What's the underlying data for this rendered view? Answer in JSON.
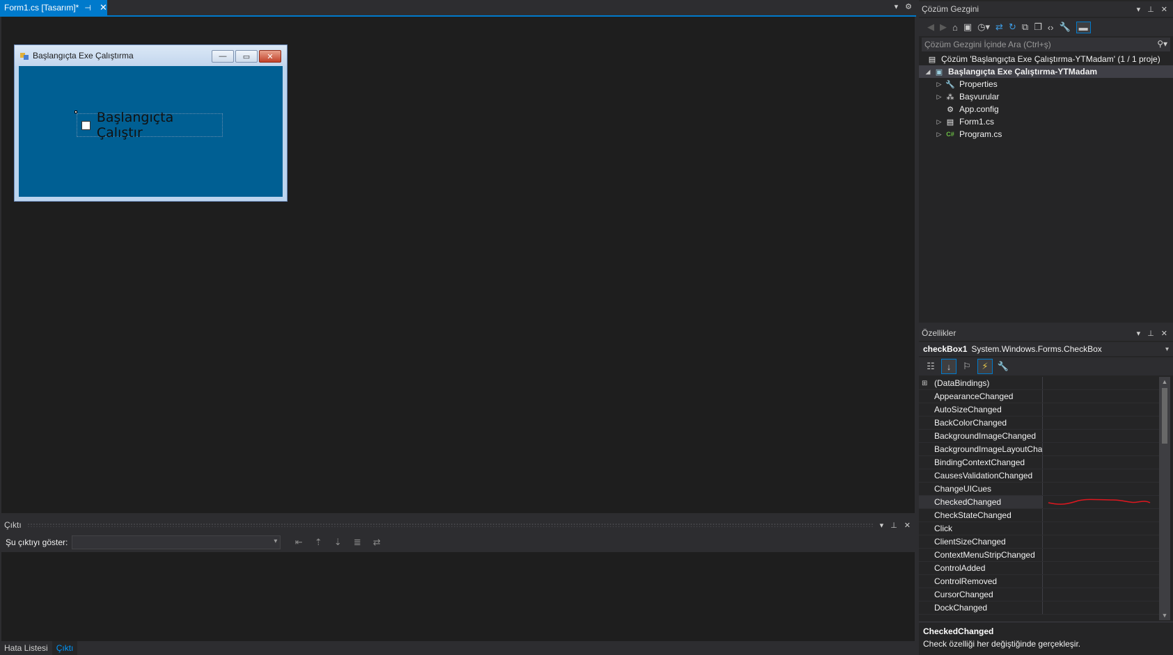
{
  "designer": {
    "tab_title": "Form1.cs [Tasarım]*",
    "pin_glyph": "⊣",
    "close_glyph": "✕",
    "form": {
      "title": "Başlangıçta Exe Çalıştırma",
      "min_glyph": "—",
      "max_glyph": "▭",
      "close_glyph": "✕",
      "checkbox_label": "Başlangıçta Çalıştır"
    }
  },
  "output": {
    "title": "Çıktı",
    "show_label": "Şu çıktıyı göster:",
    "selected_source": ""
  },
  "bottom_tabs": [
    {
      "label": "Hata Listesi"
    },
    {
      "label": "Çıktı"
    }
  ],
  "solution_explorer": {
    "title": "Çözüm Gezgini",
    "search_placeholder": "Çözüm Gezgini İçinde Ara (Ctrl+ş)",
    "tree": [
      {
        "label": "Çözüm 'Başlangıçta Exe Çalıştırma-YTMadam' (1 / 1 proje)",
        "icon": "solution-icon"
      },
      {
        "label": "Başlangıçta Exe Çalıştırma-YTMadam",
        "icon": "csharp-project-icon"
      },
      {
        "label": "Properties",
        "icon": "wrench-icon"
      },
      {
        "label": "Başvurular",
        "icon": "references-icon"
      },
      {
        "label": "App.config",
        "icon": "config-file-icon"
      },
      {
        "label": "Form1.cs",
        "icon": "form-icon"
      },
      {
        "label": "Program.cs",
        "icon": "csharp-file-icon"
      }
    ]
  },
  "properties": {
    "title": "Özellikler",
    "object_name": "checkBox1",
    "object_type": "System.Windows.Forms.CheckBox",
    "rows": [
      {
        "name": "(DataBindings)"
      },
      {
        "name": "AppearanceChanged"
      },
      {
        "name": "AutoSizeChanged"
      },
      {
        "name": "BackColorChanged"
      },
      {
        "name": "BackgroundImageChanged"
      },
      {
        "name": "BackgroundImageLayoutCha"
      },
      {
        "name": "BindingContextChanged"
      },
      {
        "name": "CausesValidationChanged"
      },
      {
        "name": "ChangeUICues"
      },
      {
        "name": "CheckedChanged"
      },
      {
        "name": "CheckStateChanged"
      },
      {
        "name": "Click"
      },
      {
        "name": "ClientSizeChanged"
      },
      {
        "name": "ContextMenuStripChanged"
      },
      {
        "name": "ControlAdded"
      },
      {
        "name": "ControlRemoved"
      },
      {
        "name": "CursorChanged"
      },
      {
        "name": "DockChanged"
      }
    ],
    "description_title": "CheckedChanged",
    "description_text": "Check özelliği her değiştiğinde gerçekleşir."
  },
  "colors": {
    "accent": "#007acc",
    "form_client": "#005f93",
    "squiggle": "#e0171f"
  }
}
